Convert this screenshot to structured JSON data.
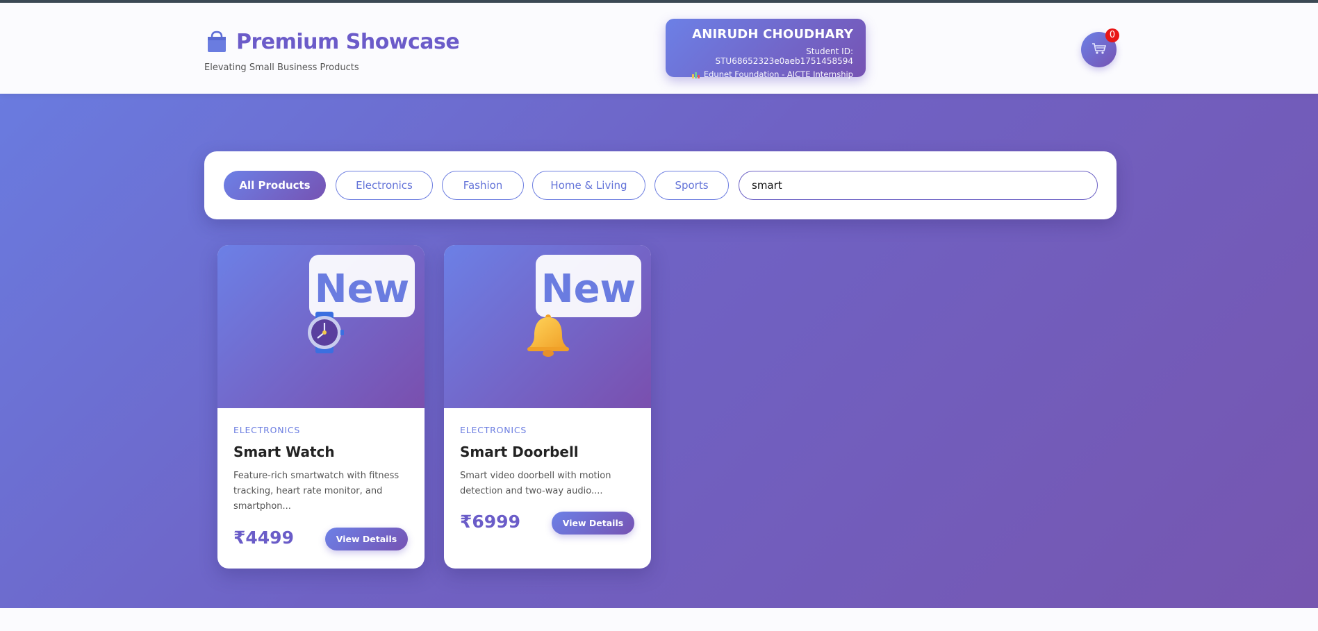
{
  "header": {
    "brand_title": "Premium Showcase",
    "brand_subtitle": "Elevating Small Business Products",
    "brand_icon": "shopping-bag-icon",
    "student": {
      "name": "ANIRUDH CHOUDHARY",
      "id_text": "Student ID: STU68652323e0aeb1751458594",
      "org_text": "Edunet Foundation - AICTE Internship"
    },
    "cart": {
      "icon": "cart-icon",
      "count": "0"
    }
  },
  "filters": {
    "chips": [
      {
        "label": "All Products",
        "active": true
      },
      {
        "label": "Electronics",
        "active": false
      },
      {
        "label": "Fashion",
        "active": false
      },
      {
        "label": "Home & Living",
        "active": false
      },
      {
        "label": "Sports",
        "active": false
      }
    ],
    "search_value": "smart"
  },
  "products": [
    {
      "badge": "New",
      "icon": "watch-icon",
      "category": "ELECTRONICS",
      "title": "Smart Watch",
      "description": "Feature-rich smartwatch with fitness tracking, heart rate monitor, and smartphon...",
      "price": "₹4499",
      "button_label": "View Details"
    },
    {
      "badge": "New",
      "icon": "bell-icon",
      "category": "ELECTRONICS",
      "title": "Smart Doorbell",
      "description": "Smart video doorbell with motion detection and two-way audio....",
      "price": "₹6999",
      "button_label": "View Details"
    }
  ],
  "colors": {
    "accent": "#6a7ce0",
    "accent_dark": "#7653b3",
    "badge_red": "#e81515"
  }
}
